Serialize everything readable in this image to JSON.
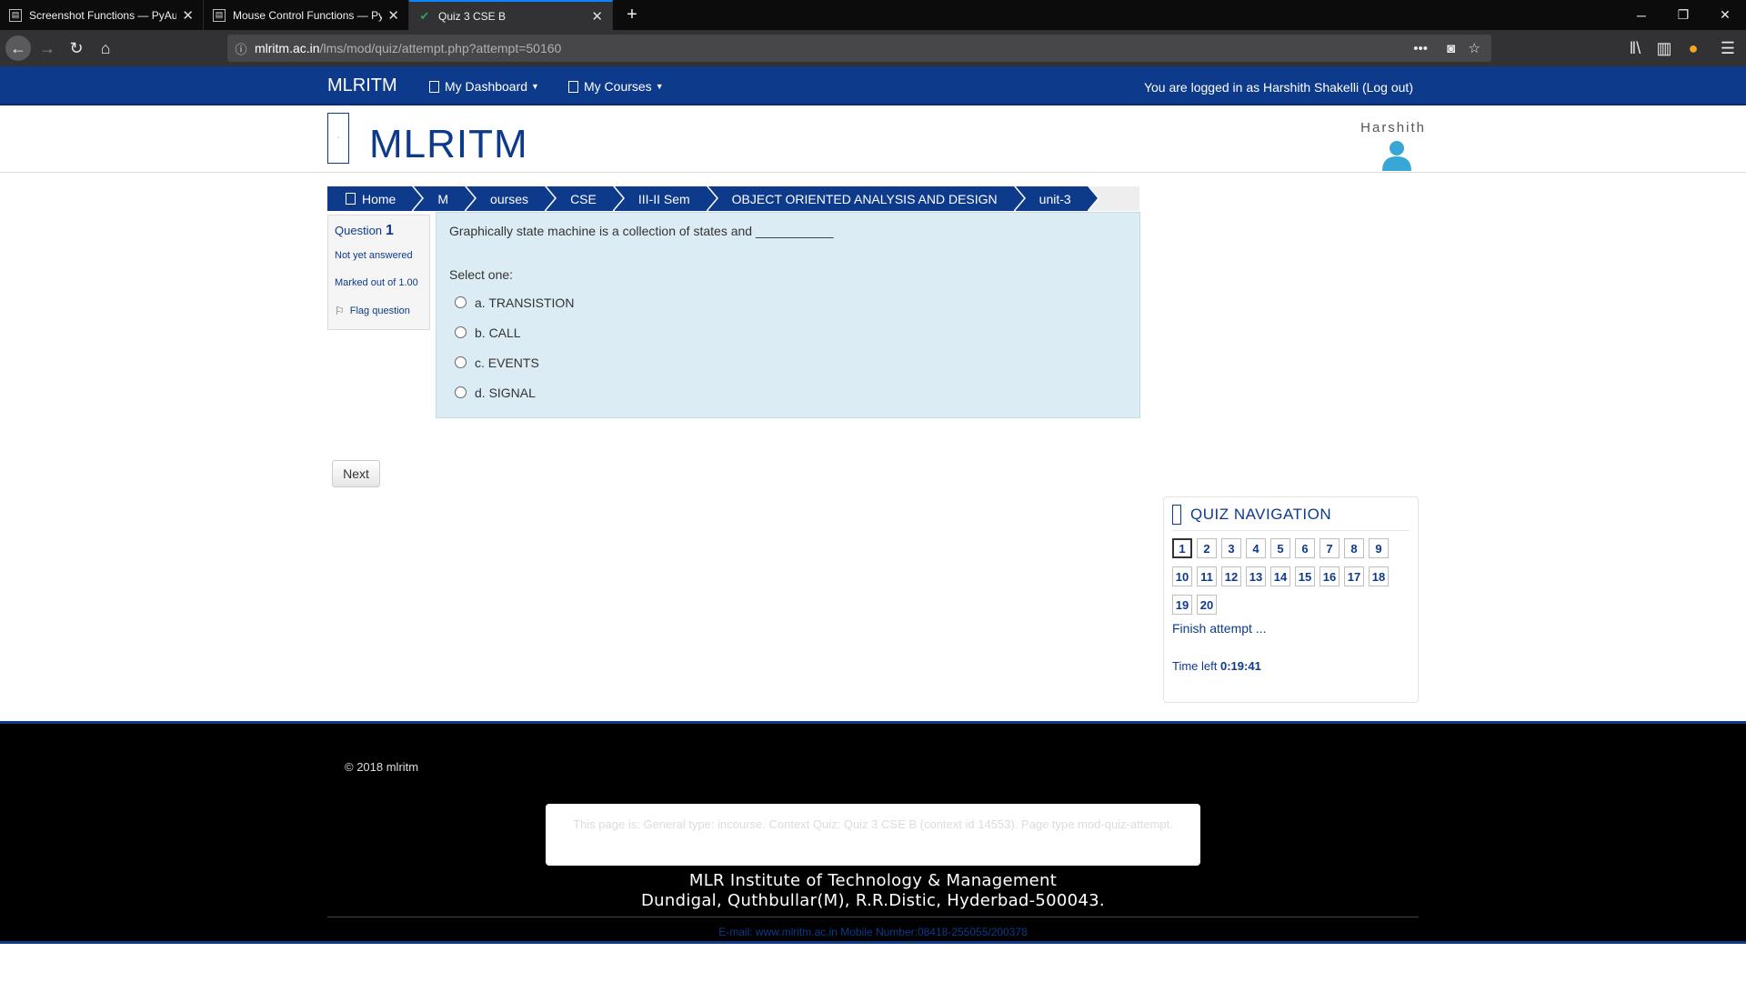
{
  "browser": {
    "tabs": [
      {
        "title": "Screenshot Functions — PyAut",
        "active": false
      },
      {
        "title": "Mouse Control Functions — Py",
        "active": false
      },
      {
        "title": "Quiz 3 CSE B",
        "active": true
      }
    ],
    "url_host": "mlritm.ac.in",
    "url_path": "/lms/mod/quiz/attempt.php?attempt=50160",
    "page_actions_icon": "•••"
  },
  "topbar": {
    "brand": "MLRITM",
    "menu_dashboard": "My Dashboard",
    "menu_courses": "My Courses",
    "login_prefix": "You are logged in as Harshith Shakelli (",
    "logout": "Log out",
    "login_suffix": ")"
  },
  "header": {
    "site_name": "MLRITM",
    "username": "Harshith"
  },
  "breadcrumb": [
    "Home",
    "M",
    "ourses",
    "CSE",
    "III-II Sem",
    "OBJECT ORIENTED ANALYSIS AND DESIGN",
    "unit-3"
  ],
  "question": {
    "label": "Question",
    "number": "1",
    "state": "Not yet answered",
    "grade": "Marked out of 1.00",
    "flag": "Flag question",
    "text": "Graphically state machine is a collection of states and ___________",
    "prompt": "Select one:",
    "answers": [
      "a. TRANSISTION",
      "b. CALL",
      "c. EVENTS",
      "d. SIGNAL"
    ]
  },
  "next_label": "Next",
  "quiz_nav": {
    "title": "QUIZ NAVIGATION",
    "questions": [
      "1",
      "2",
      "3",
      "4",
      "5",
      "6",
      "7",
      "8",
      "9",
      "10",
      "11",
      "12",
      "13",
      "14",
      "15",
      "16",
      "17",
      "18",
      "19",
      "20"
    ],
    "current": "1",
    "finish": "Finish attempt ...",
    "time_label": "Time left",
    "time_value": "0:19:41"
  },
  "footer": {
    "copyright": "© 2018 mlritm",
    "page_info": "This page is: General type: incourse. Context Quiz: Quiz 3 CSE B (context id 14553). Page type mod-quiz-attempt.",
    "institute": "MLR Institute of Technology & Management",
    "address": "Dundigal, Quthbullar(M), R.R.Distic, Hyderbad-500043.",
    "email": "E-mail: www.mlritm.ac.in Mobile Number:08418-255055/200378"
  },
  "colors": {
    "brand_blue": "#0e3a8c",
    "question_bg": "#dcecf4",
    "avatar": "#39a7d6"
  }
}
